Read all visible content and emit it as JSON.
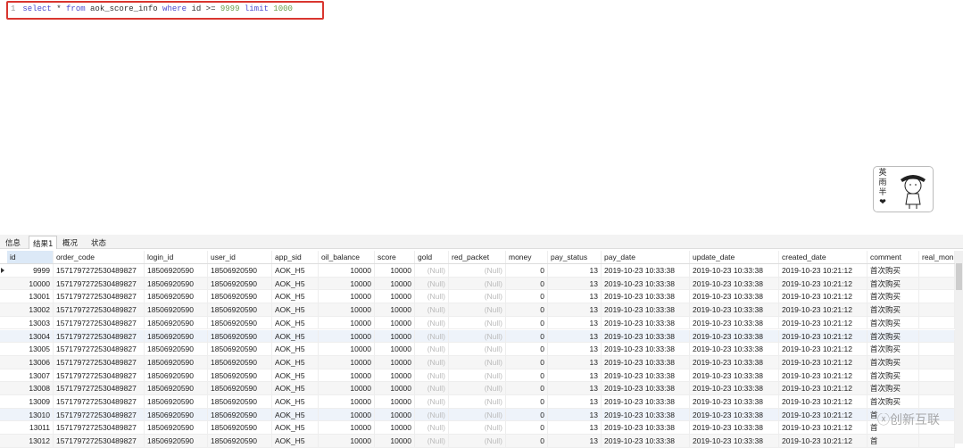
{
  "editor": {
    "line_number": "1",
    "sql": {
      "kw1": "select",
      "star": " * ",
      "kw2": "from",
      "table": " aok_score_info ",
      "kw3": "where",
      "cond": " id >= ",
      "n1": "9999",
      "kw4": " limit ",
      "n2": "1000"
    }
  },
  "sticker": {
    "text": [
      "英",
      "雨",
      "半",
      "❤"
    ]
  },
  "tabs": [
    "信息",
    "结果1",
    "概况",
    "状态"
  ],
  "active_tab": 1,
  "columns": [
    "id",
    "order_code",
    "login_id",
    "user_id",
    "app_sid",
    "oil_balance",
    "score",
    "gold",
    "red_packet",
    "money",
    "pay_status",
    "pay_date",
    "update_date",
    "created_date",
    "comment",
    "real_mon"
  ],
  "rows": [
    [
      "9999",
      "1571797272530489827",
      "18506920590",
      "18506920590",
      "AOK_H5",
      "10000",
      "10000",
      "(Null)",
      "(Null)",
      "0",
      "13",
      "2019-10-23 10:33:38",
      "2019-10-23 10:33:38",
      "2019-10-23 10:21:12",
      "首次购买",
      ""
    ],
    [
      "10000",
      "1571797272530489827",
      "18506920590",
      "18506920590",
      "AOK_H5",
      "10000",
      "10000",
      "(Null)",
      "(Null)",
      "0",
      "13",
      "2019-10-23 10:33:38",
      "2019-10-23 10:33:38",
      "2019-10-23 10:21:12",
      "首次购买",
      ""
    ],
    [
      "13001",
      "1571797272530489827",
      "18506920590",
      "18506920590",
      "AOK_H5",
      "10000",
      "10000",
      "(Null)",
      "(Null)",
      "0",
      "13",
      "2019-10-23 10:33:38",
      "2019-10-23 10:33:38",
      "2019-10-23 10:21:12",
      "首次购买",
      ""
    ],
    [
      "13002",
      "1571797272530489827",
      "18506920590",
      "18506920590",
      "AOK_H5",
      "10000",
      "10000",
      "(Null)",
      "(Null)",
      "0",
      "13",
      "2019-10-23 10:33:38",
      "2019-10-23 10:33:38",
      "2019-10-23 10:21:12",
      "首次购买",
      ""
    ],
    [
      "13003",
      "1571797272530489827",
      "18506920590",
      "18506920590",
      "AOK_H5",
      "10000",
      "10000",
      "(Null)",
      "(Null)",
      "0",
      "13",
      "2019-10-23 10:33:38",
      "2019-10-23 10:33:38",
      "2019-10-23 10:21:12",
      "首次购买",
      ""
    ],
    [
      "13004",
      "1571797272530489827",
      "18506920590",
      "18506920590",
      "AOK_H5",
      "10000",
      "10000",
      "(Null)",
      "(Null)",
      "0",
      "13",
      "2019-10-23 10:33:38",
      "2019-10-23 10:33:38",
      "2019-10-23 10:21:12",
      "首次购买",
      ""
    ],
    [
      "13005",
      "1571797272530489827",
      "18506920590",
      "18506920590",
      "AOK_H5",
      "10000",
      "10000",
      "(Null)",
      "(Null)",
      "0",
      "13",
      "2019-10-23 10:33:38",
      "2019-10-23 10:33:38",
      "2019-10-23 10:21:12",
      "首次购买",
      ""
    ],
    [
      "13006",
      "1571797272530489827",
      "18506920590",
      "18506920590",
      "AOK_H5",
      "10000",
      "10000",
      "(Null)",
      "(Null)",
      "0",
      "13",
      "2019-10-23 10:33:38",
      "2019-10-23 10:33:38",
      "2019-10-23 10:21:12",
      "首次购买",
      ""
    ],
    [
      "13007",
      "1571797272530489827",
      "18506920590",
      "18506920590",
      "AOK_H5",
      "10000",
      "10000",
      "(Null)",
      "(Null)",
      "0",
      "13",
      "2019-10-23 10:33:38",
      "2019-10-23 10:33:38",
      "2019-10-23 10:21:12",
      "首次购买",
      ""
    ],
    [
      "13008",
      "1571797272530489827",
      "18506920590",
      "18506920590",
      "AOK_H5",
      "10000",
      "10000",
      "(Null)",
      "(Null)",
      "0",
      "13",
      "2019-10-23 10:33:38",
      "2019-10-23 10:33:38",
      "2019-10-23 10:21:12",
      "首次购买",
      ""
    ],
    [
      "13009",
      "1571797272530489827",
      "18506920590",
      "18506920590",
      "AOK_H5",
      "10000",
      "10000",
      "(Null)",
      "(Null)",
      "0",
      "13",
      "2019-10-23 10:33:38",
      "2019-10-23 10:33:38",
      "2019-10-23 10:21:12",
      "首次购买",
      ""
    ],
    [
      "13010",
      "1571797272530489827",
      "18506920590",
      "18506920590",
      "AOK_H5",
      "10000",
      "10000",
      "(Null)",
      "(Null)",
      "0",
      "13",
      "2019-10-23 10:33:38",
      "2019-10-23 10:33:38",
      "2019-10-23 10:21:12",
      "首",
      ""
    ],
    [
      "13011",
      "1571797272530489827",
      "18506920590",
      "18506920590",
      "AOK_H5",
      "10000",
      "10000",
      "(Null)",
      "(Null)",
      "0",
      "13",
      "2019-10-23 10:33:38",
      "2019-10-23 10:33:38",
      "2019-10-23 10:21:12",
      "首",
      ""
    ],
    [
      "13012",
      "1571797272530489827",
      "18506920590",
      "18506920590",
      "AOK_H5",
      "10000",
      "10000",
      "(Null)",
      "(Null)",
      "0",
      "13",
      "2019-10-23 10:33:38",
      "2019-10-23 10:33:38",
      "2019-10-23 10:21:12",
      "首",
      ""
    ]
  ],
  "watermark": "创新互联"
}
